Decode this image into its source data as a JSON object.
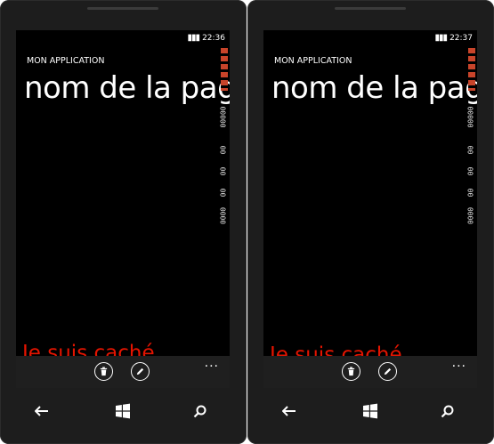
{
  "phones": [
    {
      "clock": "22:36",
      "app_title": "MON APPLICATION",
      "page_title": "nom de la page",
      "hidden_text": "Je suis caché",
      "counters": [
        "000",
        "00000",
        "00",
        "00",
        "00",
        "0000"
      ],
      "app_bar": {
        "buttons": [
          "delete",
          "edit"
        ],
        "more": "..."
      }
    },
    {
      "clock": "22:37",
      "app_title": "MON APPLICATION",
      "page_title": "nom de la page",
      "hidden_text": "Je suis caché",
      "counters": [
        "000",
        "00000",
        "00",
        "00",
        "00",
        "0000"
      ],
      "app_bar": {
        "buttons": [
          "delete",
          "edit"
        ],
        "more": "..."
      }
    }
  ],
  "icons": {
    "status": [
      "signal-icon",
      "battery-icon"
    ],
    "nav": [
      "back-icon",
      "windows-start-icon",
      "search-icon"
    ]
  },
  "colors": {
    "hidden_text": "#e51400",
    "counter_accent": "#c8442a",
    "screen_bg": "#000000",
    "app_bar": "#1f1f1f"
  }
}
